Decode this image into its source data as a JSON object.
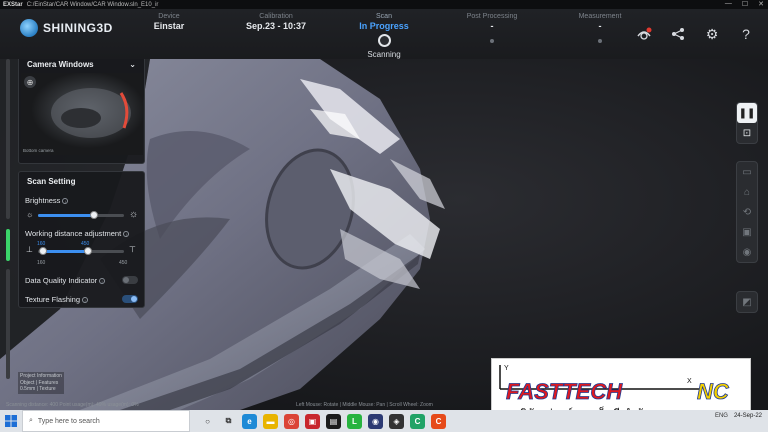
{
  "window": {
    "app_name": "EXStar",
    "path": "C:/EinStar/CAR Window/CAR Window.sln_E10_ir",
    "controls": [
      "—",
      "☐",
      "✕"
    ]
  },
  "header": {
    "brand": "SHINING3D",
    "steps": [
      {
        "label": "Device",
        "value": "Einstar"
      },
      {
        "label": "Calibration",
        "value": "Sep.23 - 10:37"
      },
      {
        "label": "Scan",
        "value": "In Progress",
        "status": "Scanning"
      },
      {
        "label": "Post Processing",
        "value": "-"
      },
      {
        "label": "Measurement",
        "value": "-"
      }
    ]
  },
  "camera_panel": {
    "title": "Camera Windows",
    "footer": "Bottom camera"
  },
  "scan_setting": {
    "title": "Scan Setting",
    "brightness_label": "Brightness",
    "brightness_level": 0.65,
    "working_distance_label": "Working distance adjustment",
    "wd_min": "160",
    "wd_max": "450",
    "wd_low_value": "160",
    "wd_high_value": "450",
    "wd_range_low": 0.06,
    "wd_range_high": 0.58,
    "data_quality_label": "Data Quality Indicator",
    "data_quality_on": false,
    "texture_flashing_label": "Texture Flashing",
    "texture_flashing_on": true
  },
  "bottom": {
    "project_info_title": "Project Information",
    "project_info_line1": "Object | Features",
    "project_info_line2": "0.5mm | Texture",
    "status_line": "Scanning distance: 400  Point usage(m): 49%  usage(m): 0%",
    "mouse_hint": "Left Mouse: Rotate | Middle Mouse: Pan | Scroll Wheel: Zoom"
  },
  "watermark": {
    "brand_red": "FASTTECH",
    "brand_yellow": "NC",
    "thai_text": "บริษัท  ฟาสท์เทค  เอ็นซี  จำกัด",
    "axis_y": "Y",
    "axis_x": "X"
  },
  "taskbar": {
    "search_placeholder": "Type here to search",
    "lang": "ENG",
    "date": "24-Sep-22"
  },
  "colors": {
    "accent": "#3c8ff0",
    "active_step": "#4aa3ff",
    "indicator_green": "#3bd46a",
    "brand_red": "#e0191e",
    "brand_blue": "#1f3a93",
    "brand_yellow": "#f4d000"
  }
}
